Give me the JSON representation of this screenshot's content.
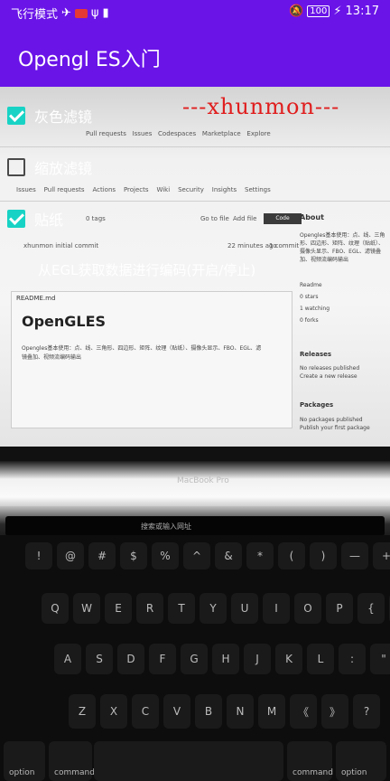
{
  "status": {
    "airplane_text": "飞行模式",
    "battery_percent": "100",
    "time": "13:17"
  },
  "app": {
    "title": "Opengl ES入门"
  },
  "options": [
    {
      "label": "灰色滤镜",
      "checked": true
    },
    {
      "label": "缩放滤镜",
      "checked": false
    },
    {
      "label": "贴纸",
      "checked": true
    }
  ],
  "encode_label": "从EGL获取数据进行编码(开启/停止)",
  "watermark": "---xhunmon---",
  "camera": {
    "nav": [
      "Pull requests",
      "Issues",
      "Codespaces",
      "Marketplace",
      "Explore"
    ],
    "repo_tabs": [
      "Issues",
      "Pull requests",
      "Actions",
      "Projects",
      "Wiki",
      "Security",
      "Insights",
      "Settings"
    ],
    "tags": "0 tags",
    "go_to_file": "Go to file",
    "add_file": "Add file",
    "code_btn": "Code",
    "commit_user": "xhunmon initial commit",
    "commit_time": "22 minutes ago",
    "commit_count": "1 commit",
    "readme_file": "README.md",
    "readme_title": "OpenGLES",
    "readme_desc": "Opengles基本使用：点、线、三角形、四边形、矩阵、纹理（贴纸）、摄像头显示、FBO、EGL、滤镜叠加、视频流编码输出",
    "about_title": "About",
    "about_desc": "Opengles基本使用：点、线、三角形、四边形、矩阵、纹理（贴纸）、摄像头显示、FBO、EGL、滤镜叠加、视频流编码输出",
    "about_items": [
      "Readme",
      "0 stars",
      "1 watching",
      "0 forks"
    ],
    "releases_title": "Releases",
    "releases_desc": "No releases published",
    "releases_link": "Create a new release",
    "packages_title": "Packages",
    "packages_desc": "No packages published",
    "packages_link": "Publish your first package",
    "laptop_brand": "MacBook Pro",
    "touchbar_search": "搜索或输入网址",
    "key_labels": {
      "row1": [
        "!",
        "@",
        "#",
        "$",
        "%",
        "^",
        "&",
        "*",
        "(",
        ")",
        "—",
        "+"
      ],
      "row2": [
        "Q",
        "W",
        "E",
        "R",
        "T",
        "Y",
        "U",
        "I",
        "O",
        "P",
        "{",
        "}"
      ],
      "row3": [
        "A",
        "S",
        "D",
        "F",
        "G",
        "H",
        "J",
        "K",
        "L",
        ":",
        "\""
      ],
      "row4": [
        "Z",
        "X",
        "C",
        "V",
        "B",
        "N",
        "M",
        "《",
        "》",
        "?"
      ],
      "option": "option",
      "command": "command"
    }
  }
}
